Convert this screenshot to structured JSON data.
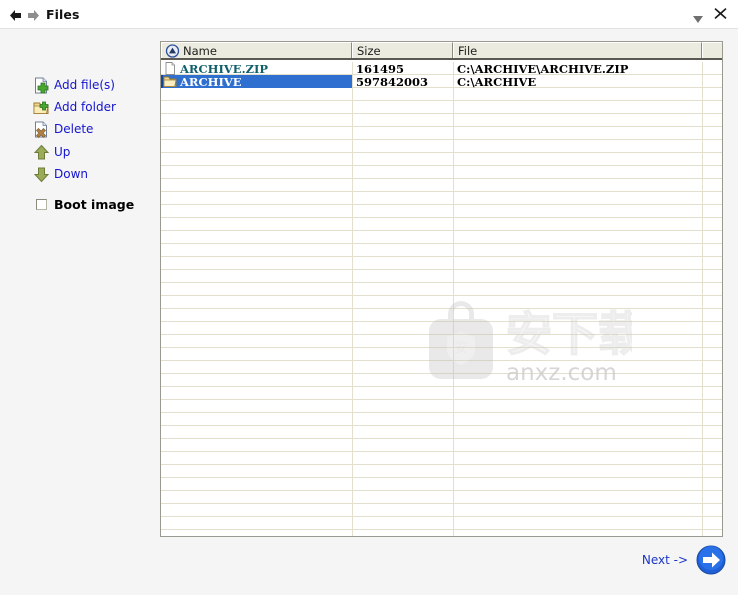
{
  "window": {
    "title": "Files",
    "back_icon": "back-arrow-icon",
    "forward_icon": "forward-arrow-icon",
    "dropdown_icon": "chevron-down-icon",
    "close_icon": "close-icon"
  },
  "sidebar": {
    "items": [
      {
        "label": "Add file(s)",
        "icon": "add-file-icon"
      },
      {
        "label": "Add folder",
        "icon": "add-folder-icon"
      },
      {
        "label": "Delete",
        "icon": "delete-file-icon"
      },
      {
        "label": "Up",
        "icon": "arrow-up-icon"
      },
      {
        "label": "Down",
        "icon": "arrow-down-icon"
      }
    ],
    "boot_image": {
      "label": "Boot image",
      "checked": false
    }
  },
  "filelist": {
    "sort_icon": "sort-ascending-icon",
    "columns": [
      {
        "label": "Name"
      },
      {
        "label": "Size"
      },
      {
        "label": "File"
      },
      {
        "label": ""
      }
    ],
    "rows": [
      {
        "icon": "file-icon",
        "name": "ARCHIVE.ZIP",
        "size": "161495",
        "file": "C:\\ARCHIVE\\ARCHIVE.ZIP",
        "selected": false
      },
      {
        "icon": "folder-icon",
        "name": "ARCHIVE",
        "size": "597842003",
        "file": "C:\\ARCHIVE",
        "selected": true
      }
    ]
  },
  "watermark": {
    "site": "anxz.com",
    "text_cn": "安下载"
  },
  "footer": {
    "next_label": "Next ->",
    "next_icon": "arrow-right-circle-icon"
  },
  "colors": {
    "link": "#1414cd",
    "selection": "#2f6fd0",
    "header_bg": "#ecebdf",
    "grid_line": "#e2e0cd",
    "accent_next": "#1a36c8"
  }
}
